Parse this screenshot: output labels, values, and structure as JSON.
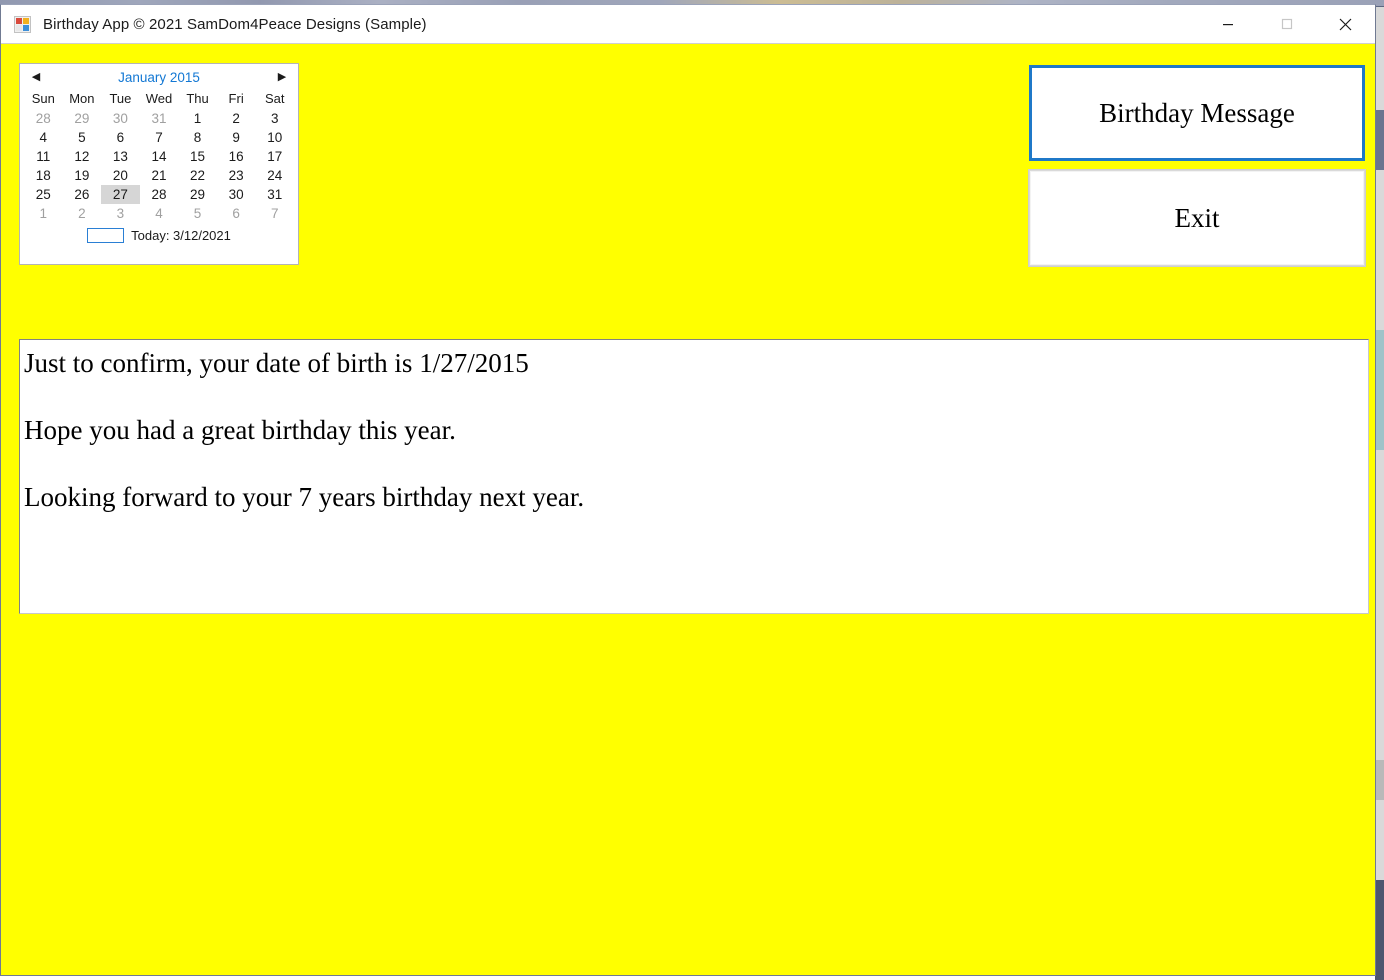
{
  "window": {
    "title": "Birthday App © 2021 SamDom4Peace Designs (Sample)",
    "icon_name": "winforms-app-icon",
    "background_color": "#ffff00",
    "controls": {
      "minimize_label": "Minimize",
      "maximize_label": "Maximize",
      "close_label": "Close"
    }
  },
  "calendar": {
    "title": "January 2015",
    "prev_arrow": "◀",
    "next_arrow": "▶",
    "day_names": [
      "Sun",
      "Mon",
      "Tue",
      "Wed",
      "Thu",
      "Fri",
      "Sat"
    ],
    "weeks": [
      [
        {
          "d": "28",
          "other": true
        },
        {
          "d": "29",
          "other": true
        },
        {
          "d": "30",
          "other": true
        },
        {
          "d": "31",
          "other": true
        },
        {
          "d": "1"
        },
        {
          "d": "2"
        },
        {
          "d": "3"
        }
      ],
      [
        {
          "d": "4"
        },
        {
          "d": "5"
        },
        {
          "d": "6"
        },
        {
          "d": "7"
        },
        {
          "d": "8"
        },
        {
          "d": "9"
        },
        {
          "d": "10"
        }
      ],
      [
        {
          "d": "11"
        },
        {
          "d": "12"
        },
        {
          "d": "13"
        },
        {
          "d": "14"
        },
        {
          "d": "15"
        },
        {
          "d": "16"
        },
        {
          "d": "17"
        }
      ],
      [
        {
          "d": "18"
        },
        {
          "d": "19"
        },
        {
          "d": "20"
        },
        {
          "d": "21"
        },
        {
          "d": "22"
        },
        {
          "d": "23"
        },
        {
          "d": "24"
        }
      ],
      [
        {
          "d": "25"
        },
        {
          "d": "26"
        },
        {
          "d": "27",
          "selected": true
        },
        {
          "d": "28"
        },
        {
          "d": "29"
        },
        {
          "d": "30"
        },
        {
          "d": "31"
        }
      ],
      [
        {
          "d": "1",
          "other": true
        },
        {
          "d": "2",
          "other": true
        },
        {
          "d": "3",
          "other": true
        },
        {
          "d": "4",
          "other": true
        },
        {
          "d": "5",
          "other": true
        },
        {
          "d": "6",
          "other": true
        },
        {
          "d": "7",
          "other": true
        }
      ]
    ],
    "selected_date": "27",
    "today_label": "Today: 3/12/2021",
    "title_color": "#1378d4",
    "selection_color": "#d6d6d6"
  },
  "buttons": {
    "birthday_message_label": "Birthday Message",
    "exit_label": "Exit",
    "focus_border_color": "#1f78c8"
  },
  "message": {
    "line1": "Just to confirm, your date of birth is 1/27/2015",
    "line2": "Hope you had a great birthday this year.",
    "line3": "Looking forward to your 7 years birthday next year."
  }
}
